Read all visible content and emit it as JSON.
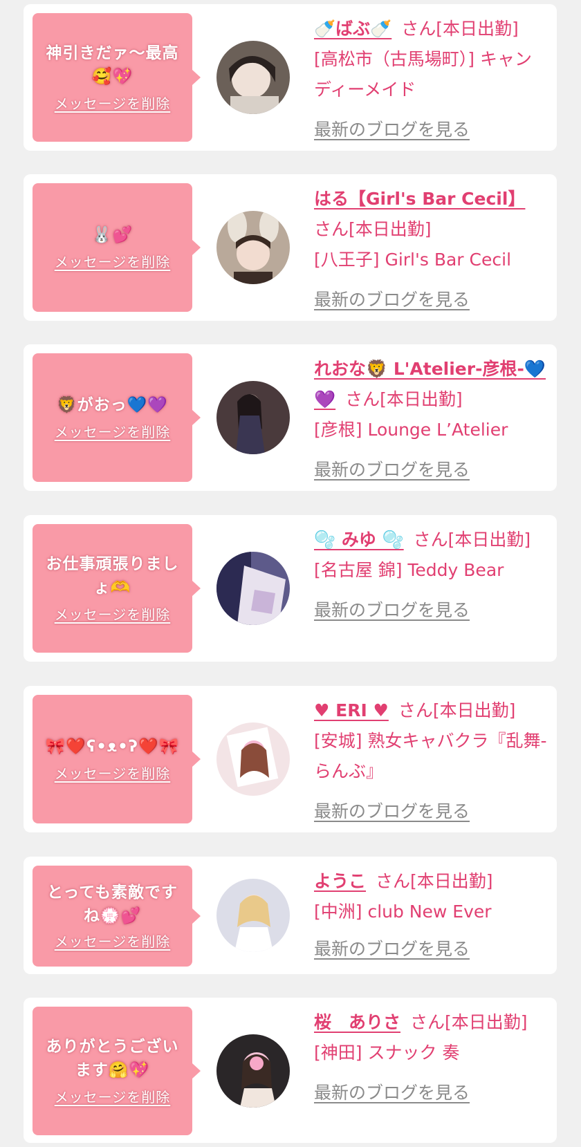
{
  "delete_label": "メッセージを削除",
  "blog_label": "最新のブログを見る",
  "status_suffix": "さん[本日出勤]",
  "colors": {
    "page_bg": "#f0f0f0",
    "card_bg": "#ffffff",
    "bubble": "#f99aa7",
    "accent": "#e13f71",
    "link_gray": "#8a8a8a"
  },
  "cards": [
    {
      "message": "神引きだァ〜最高🥰💖",
      "name": "🍼ばぶ🍼",
      "shop": "[高松市（古馬場町）] キャンディーメイド"
    },
    {
      "message": "🐰💕",
      "name": "はる【Girl's Bar Cecil】",
      "shop": "[八王子] Girl's Bar Cecil"
    },
    {
      "message": "🦁がおっ💙💜",
      "name": "れおな🦁 L'Atelier-彦根-💙💜",
      "shop": "[彦根] Lounge L’Atelier"
    },
    {
      "message": "お仕事頑張りましょ🫶",
      "name": "🫧 みゆ 🫧",
      "shop": "[名古屋 錦] Teddy Bear"
    },
    {
      "message": "🎀❤️ʕ•ᴥ•ʔ❤️🎀",
      "name": "♥ ERI ♥",
      "shop": "[安城] 熟女キャバクラ『乱舞-らんぶ』"
    },
    {
      "message": "とっても素敵ですね💮💕",
      "name": "ようこ",
      "shop": "[中洲] club New Ever"
    },
    {
      "message": "ありがとうございます🤗💖",
      "name": "桜　ありさ",
      "shop": "[神田] スナック 奏"
    }
  ]
}
